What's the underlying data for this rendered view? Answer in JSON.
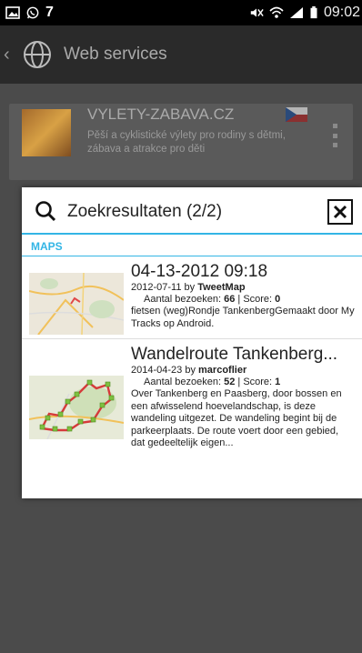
{
  "statusbar": {
    "carrier_text": "7",
    "time": "09:02"
  },
  "actionbar": {
    "title": "Web services"
  },
  "background_card": {
    "title": "VYLETY-ZABAVA.CZ",
    "description": "Pěší a cyklistické výlety pro rodiny s dětmi, zábava a atrakce pro děti"
  },
  "dialog": {
    "title": "Zoekresultaten (2/2)",
    "section": "MAPS",
    "results": [
      {
        "title": "04-13-2012 09:18",
        "date": "2012-07-11",
        "by_word": "by",
        "author": "TweetMap",
        "visits_label": "Aantal bezoeken:",
        "visits": "66",
        "score_label": "Score:",
        "score": "0",
        "description": "fietsen (weg)Rondje TankenbergGemaakt door My Tracks op Android."
      },
      {
        "title": "Wandelroute Tankenberg...",
        "date": "2014-04-23",
        "by_word": "by",
        "author": "marcoflier",
        "visits_label": "Aantal bezoeken:",
        "visits": "52",
        "score_label": "Score:",
        "score": "1",
        "description": "Over Tankenberg en Paasberg, door bossen en een afwisselend hoevelandschap, is deze wandeling uitgezet. De wandeling begint bij de parkeerplaats. De route voert door een gebied, dat gedeeltelijk eigen..."
      }
    ]
  },
  "colors": {
    "accent": "#33b5e5",
    "actionbar": "#2a2a2a",
    "dim": "#4b4b4b"
  }
}
